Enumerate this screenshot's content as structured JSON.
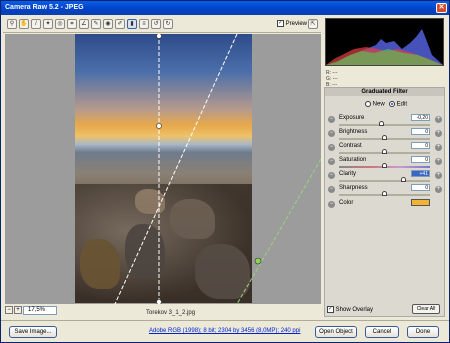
{
  "window": {
    "title": "Camera Raw 5.2  -  JPEG"
  },
  "toolbar": {
    "preview_label": "Preview",
    "tools": [
      "zoom-tool",
      "hand-tool",
      "white-balance-tool",
      "color-sampler-tool",
      "targeted-adjustment-tool",
      "crop-tool",
      "straighten-tool",
      "spot-removal-tool",
      "red-eye-tool",
      "adjustment-brush-tool",
      "graduated-filter-tool",
      "preferences-icon",
      "rotate-ccw-icon",
      "rotate-cw-icon"
    ]
  },
  "viewer": {
    "zoom": "17,5%",
    "filename": "Torekov 3_1_2.jpg"
  },
  "histogram": {
    "r": "R: ---",
    "g": "G: ---",
    "b": "B: ---"
  },
  "panel": {
    "title": "Graduated Filter",
    "new_label": "New",
    "edit_label": "Edit",
    "rows": [
      {
        "label": "Exposure",
        "value": "-0,20",
        "slider": 0.47
      },
      {
        "label": "Brightness",
        "value": "0",
        "slider": 0.5
      },
      {
        "label": "Contrast",
        "value": "0",
        "slider": 0.5
      },
      {
        "label": "Saturation",
        "value": "0",
        "slider": 0.5
      },
      {
        "label": "Clarity",
        "value": "+41",
        "slider": 0.71
      },
      {
        "label": "Sharpness",
        "value": "0",
        "slider": 0.5
      },
      {
        "label": "Color",
        "value": "",
        "slider": null,
        "color": "#f2b233"
      }
    ],
    "overlay_label": "Show Overlay",
    "clear_label": "Clear All"
  },
  "bottom": {
    "save_label": "Save Image...",
    "workflow_link": "Adobe RGB (1998); 8 bit; 2304 by 3456 (8,0MP); 240 ppi",
    "open_label": "Open Object",
    "cancel_label": "Cancel",
    "done_label": "Done"
  }
}
